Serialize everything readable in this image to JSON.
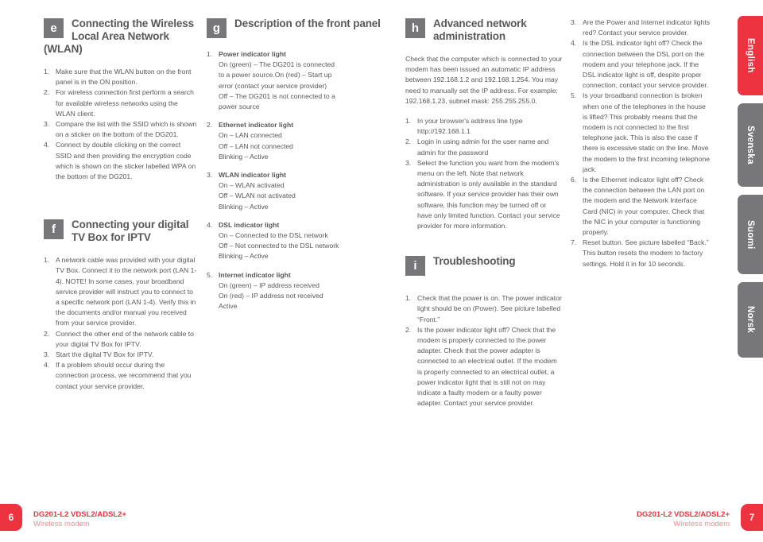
{
  "footer": {
    "left": {
      "page_number": "6",
      "title": "DG201-L2 VDSL2/ADSL2+",
      "subtitle": "Wireless modem"
    },
    "right": {
      "page_number": "7",
      "title": "DG201-L2 VDSL2/ADSL2+",
      "subtitle": "Wireless modem"
    }
  },
  "language_tabs": [
    {
      "label": "English",
      "active": true
    },
    {
      "label": "Svenska",
      "active": false
    },
    {
      "label": "Suomi",
      "active": false
    },
    {
      "label": "Norsk",
      "active": false
    }
  ],
  "sections": {
    "e": {
      "badge": "e",
      "title": "Connecting the Wireless Local Area Network (WLAN)",
      "steps": [
        "Make sure that the WLAN button on the front panel is in the ON position.",
        "For wireless connection first perform a search for available wireless networks using the WLAN client.",
        "Compare the list with the SSID which is shown on a sticker on the bottom of the DG201.",
        "Connect by double clicking on the correct SSID and then providing the encryption code which is shown on the sticker labelled WPA on the bottom of the DG201."
      ]
    },
    "f": {
      "badge": "f",
      "title": "Connecting your digital TV Box for IPTV",
      "steps": [
        "A network cable was provided with your digital TV Box. Connect it to the network port (LAN 1-4). NOTE! In some cases, your broadband service provider will instruct you to connect to a specific network port (LAN 1-4). Verify this in the documents and/or manual you received from your service provider.",
        "Connect the other end of the network cable to your digital TV Box for IPTV.",
        "Start the digital TV Box for IPTV.",
        "If a problem should occur during the connection process, we recommend that you contact your service provider."
      ]
    },
    "g": {
      "badge": "g",
      "title": "Description of the front panel",
      "items": [
        {
          "heading": "Power indicator light",
          "lines": [
            "On (green) – The DG201 is connected",
            "to a power source.On (red) – Start up",
            "error (contact your service provider)",
            "Off – The DG201 is not connected to a",
            "power source"
          ]
        },
        {
          "heading": "Ethernet indicator light",
          "lines": [
            "On – LAN connected",
            "Off – LAN not connected",
            "Blinking – Active"
          ]
        },
        {
          "heading": "WLAN indicator light",
          "lines": [
            "On – WLAN activated",
            "Off – WLAN not activated",
            "Blinking – Active"
          ]
        },
        {
          "heading": "DSL indicator light",
          "lines": [
            "On – Connected to the DSL network",
            "Off – Not connected to the DSL network",
            "Blinking – Active"
          ]
        },
        {
          "heading": "Internet indicator light",
          "lines": [
            "On (green) – IP address received",
            "On (red) – IP address not received",
            "Active"
          ]
        }
      ]
    },
    "h": {
      "badge": "h",
      "title": "Advanced network administration",
      "intro": "Check that the computer which is connected to your modem has been issued an automatic IP address between 192.168.1.2 and 192.168.1.254. You may need to manually set the IP address. For example: 192.168.1.23, subnet mask: 255.255.255.0.",
      "steps": [
        "In your browser's address line type http://192.168.1.1",
        "Login in using admin for the user name and admin for the password",
        "Select the function you want from the modem's menu on the left. Note that network administration is only available in the standard software. If your service provider has their own software, this function may be turned off or have only limited function. Contact your service provider for more information."
      ]
    },
    "i": {
      "badge": "i",
      "title": "Troubleshooting",
      "steps_left": [
        "Check that the power is on. The power indicator light should be on (Power). See picture labelled “Front.”",
        "Is the power indicator light off? Check that the modem is properly connected to the power adapter. Check that the power adapter is connected to an electrical outlet. If the modem is properly connected to an electrical outlet, a power indicator light that is still not on may indicate a faulty modem or a faulty power adapter. Contact your service provider."
      ],
      "steps_right": [
        "Are the Power and Internet indicator lights red? Contact your service provider.",
        "Is the DSL indicator light off? Check the connection between the DSL port on the modem and your telephone jack. If the DSL indicator light is off, despite proper connection, contact your service provider.",
        "Is your broadband connection is broken when one of the telephones in the house is lifted? This probably means that the modem is not connected to the first telephone jack. This is also the case if there is excessive static on the line. Move the modem to the first incoming telephone jack.",
        "Is the Ethernet indicator light off? Check the connection between the LAN port on the modem and the Network Interface Card (NIC) in your computer. Check that the NIC in your computer is functioning properly.",
        "Reset button. See picture labelled “Back.” This button resets the modem to factory settings. Hold it in for 10 seconds."
      ],
      "right_start_number": 3
    }
  },
  "colors": {
    "accent_red": "#ee3340",
    "badge_gray": "#77777a",
    "body_text": "#58585b",
    "footer_sub": "#e98e95"
  }
}
